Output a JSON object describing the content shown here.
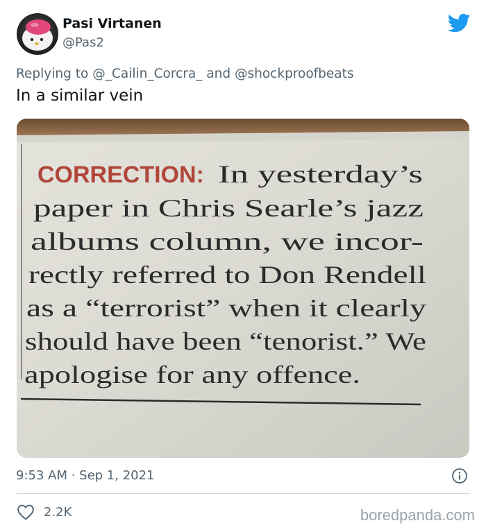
{
  "user": {
    "name": "Pasi Virtanen",
    "handle": "@Pas2"
  },
  "tweet": {
    "replying_prefix": "Replying to",
    "mention_1": "@_Cailin_Corcra_",
    "and_word": "and",
    "mention_2": "@shockproofbeats",
    "text": "In a similar vein",
    "timestamp": "9:53 AM · Sep 1, 2021",
    "likes": "2.2K"
  },
  "newspaper": {
    "heading": "CORRECTION:",
    "lines": [
      "In yesterday’s",
      "paper in Chris Searle’s jazz",
      "albums column, we incor-",
      "rectly referred to Don Rendell",
      "as a “terrorist” when it clearly",
      "should have been “tenorist.” We",
      "apologise for any offence."
    ]
  },
  "watermark": "boredpanda.com",
  "colors": {
    "twitter_blue": "#1d9bf0",
    "secondary_text": "#536471",
    "correction_red": "#b0463a"
  },
  "icons": {
    "brand": "twitter-bird-icon",
    "info": "info-icon",
    "like": "heart-icon"
  }
}
